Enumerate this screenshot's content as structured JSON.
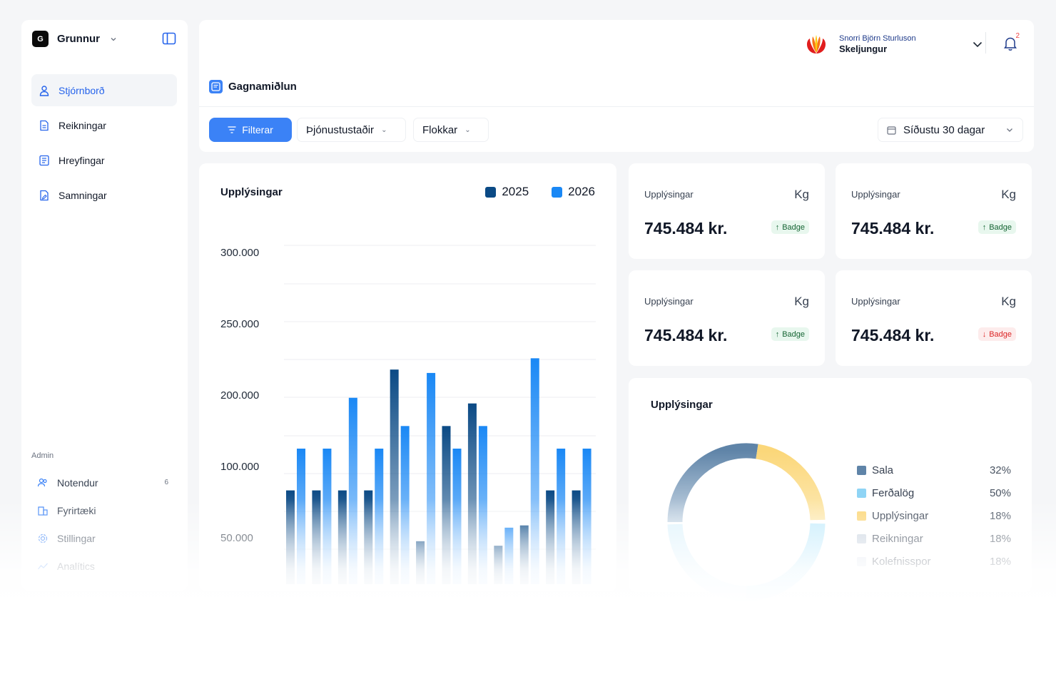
{
  "org": {
    "logo_letter": "G",
    "name": "Grunnur"
  },
  "nav": {
    "items": [
      {
        "label": "Stjórnborð",
        "icon": "user-icon",
        "active": true
      },
      {
        "label": "Reikningar",
        "icon": "document-icon",
        "active": false
      },
      {
        "label": "Hreyfingar",
        "icon": "ledger-icon",
        "active": false
      },
      {
        "label": "Samningar",
        "icon": "contract-icon",
        "active": false
      }
    ],
    "admin_label": "Admin",
    "admin_items": [
      {
        "label": "Notendur",
        "icon": "users-icon",
        "count": "6"
      },
      {
        "label": "Fyrirtæki",
        "icon": "building-icon",
        "count": ""
      },
      {
        "label": "Stillingar",
        "icon": "gear-icon",
        "count": ""
      },
      {
        "label": "Analítics",
        "icon": "chart-icon",
        "count": ""
      }
    ]
  },
  "header": {
    "user_name": "Snorri Björn Sturluson",
    "user_company": "Skeljungur",
    "notification_count": "2",
    "page_title": "Gagnamiðlun"
  },
  "filters": {
    "filter_button": "Filterar",
    "service_select": "Þjónustustaðir",
    "category_select": "Flokkar",
    "date_select": "Síðustu 30 dagar"
  },
  "bar_card": {
    "title": "Upplýsingar",
    "series_colors": [
      "#0b4a85",
      "#1a88f5"
    ]
  },
  "chart_data": {
    "type": "bar",
    "title": "Upplýsingar",
    "yticks": [
      "300.000",
      "250.000",
      "200.000",
      "100.000",
      "50.000"
    ],
    "ylim": [
      0,
      300000
    ],
    "grid": true,
    "legend_placement": "top-right",
    "series": [
      {
        "name": "2025",
        "values": [
          83000,
          83000,
          83000,
          83000,
          190000,
          38000,
          140000,
          160000,
          34000,
          52000,
          83000,
          83000
        ]
      },
      {
        "name": "2026",
        "values": [
          120000,
          120000,
          165000,
          120000,
          140000,
          187000,
          120000,
          140000,
          50000,
          200000,
          120000,
          120000
        ]
      }
    ]
  },
  "stats": [
    {
      "label": "Upplýsingar",
      "unit": "Kg",
      "value": "745.484 kr.",
      "badge": "Badge",
      "trend": "up"
    },
    {
      "label": "Upplýsingar",
      "unit": "Kg",
      "value": "745.484 kr.",
      "badge": "Badge",
      "trend": "up"
    },
    {
      "label": "Upplýsingar",
      "unit": "Kg",
      "value": "745.484 kr.",
      "badge": "Badge",
      "trend": "up"
    },
    {
      "label": "Upplýsingar",
      "unit": "Kg",
      "value": "745.484 kr.",
      "badge": "Badge",
      "trend": "down"
    }
  ],
  "donut": {
    "title": "Upplýsingar",
    "items": [
      {
        "label": "Sala",
        "value": "32%",
        "color": "#5f84a8"
      },
      {
        "label": "Ferðalög",
        "value": "50%",
        "color": "#8fd4f5"
      },
      {
        "label": "Upplýsingar",
        "value": "18%",
        "color": "#fbd77a"
      },
      {
        "label": "Reikningar",
        "value": "18%",
        "color": "#cbd5e1"
      },
      {
        "label": "Kolefnisspor",
        "value": "18%",
        "color": "#e2e8f0"
      }
    ]
  }
}
